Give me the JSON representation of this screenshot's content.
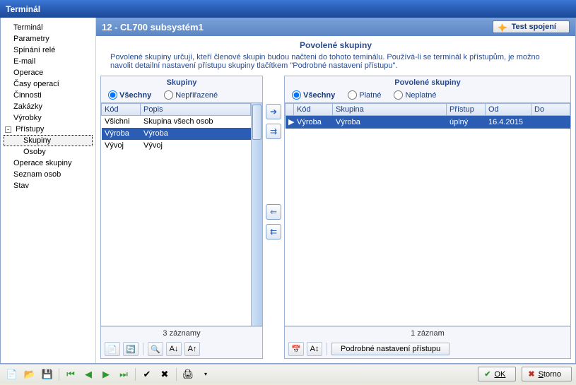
{
  "window": {
    "title": "Terminál"
  },
  "header": {
    "breadcrumb": "12  -  CL700 subsystém1",
    "test_button": "Test spojení"
  },
  "section": {
    "title": "Povolené skupiny",
    "description": "Povolené skupiny určují, kteří členové skupin budou načteni do tohoto teminálu. Používá-li se terminál k přístupům, je možno navolit detailní nastavení přístupu skupiny tlačítkem \"Podrobné nastavení přístupu\"."
  },
  "sidebar": {
    "items": [
      {
        "label": "Terminál"
      },
      {
        "label": "Parametry"
      },
      {
        "label": "Spínání relé"
      },
      {
        "label": "E-mail"
      },
      {
        "label": "Operace"
      },
      {
        "label": "Časy operací"
      },
      {
        "label": "Činnosti"
      },
      {
        "label": "Zakázky"
      },
      {
        "label": "Výrobky"
      },
      {
        "label": "Přístupy",
        "expanded": true,
        "children": [
          {
            "label": "Skupiny",
            "selected": true
          },
          {
            "label": "Osoby"
          }
        ]
      },
      {
        "label": "Operace skupiny"
      },
      {
        "label": "Seznam osob"
      },
      {
        "label": "Stav"
      }
    ]
  },
  "groups_panel": {
    "title": "Skupiny",
    "filters": {
      "all": "Všechny",
      "unassigned": "Nepřiřazené",
      "selected": "all"
    },
    "columns": {
      "code": "Kód",
      "desc": "Popis"
    },
    "rows": [
      {
        "code": "Všichni",
        "desc": "Skupina všech osob"
      },
      {
        "code": "Výroba",
        "desc": "Výroba",
        "selected": true
      },
      {
        "code": "Vývoj",
        "desc": "Vývoj"
      }
    ],
    "status": "3 záznamy"
  },
  "allowed_panel": {
    "title": "Povolené skupiny",
    "filters": {
      "all": "Všechny",
      "valid": "Platné",
      "invalid": "Neplatné",
      "selected": "all"
    },
    "columns": {
      "code": "Kód",
      "group": "Skupina",
      "access": "Přístup",
      "from": "Od",
      "to": "Do"
    },
    "rows": [
      {
        "code": "Výroba",
        "group": "Výroba",
        "access": "úplný",
        "from": "16.4.2015",
        "to": "",
        "selected": true
      }
    ],
    "status": "1 záznam",
    "detail_button": "Podrobné nastavení přístupu"
  },
  "footer": {
    "ok": "OK",
    "storno": "Storno"
  }
}
